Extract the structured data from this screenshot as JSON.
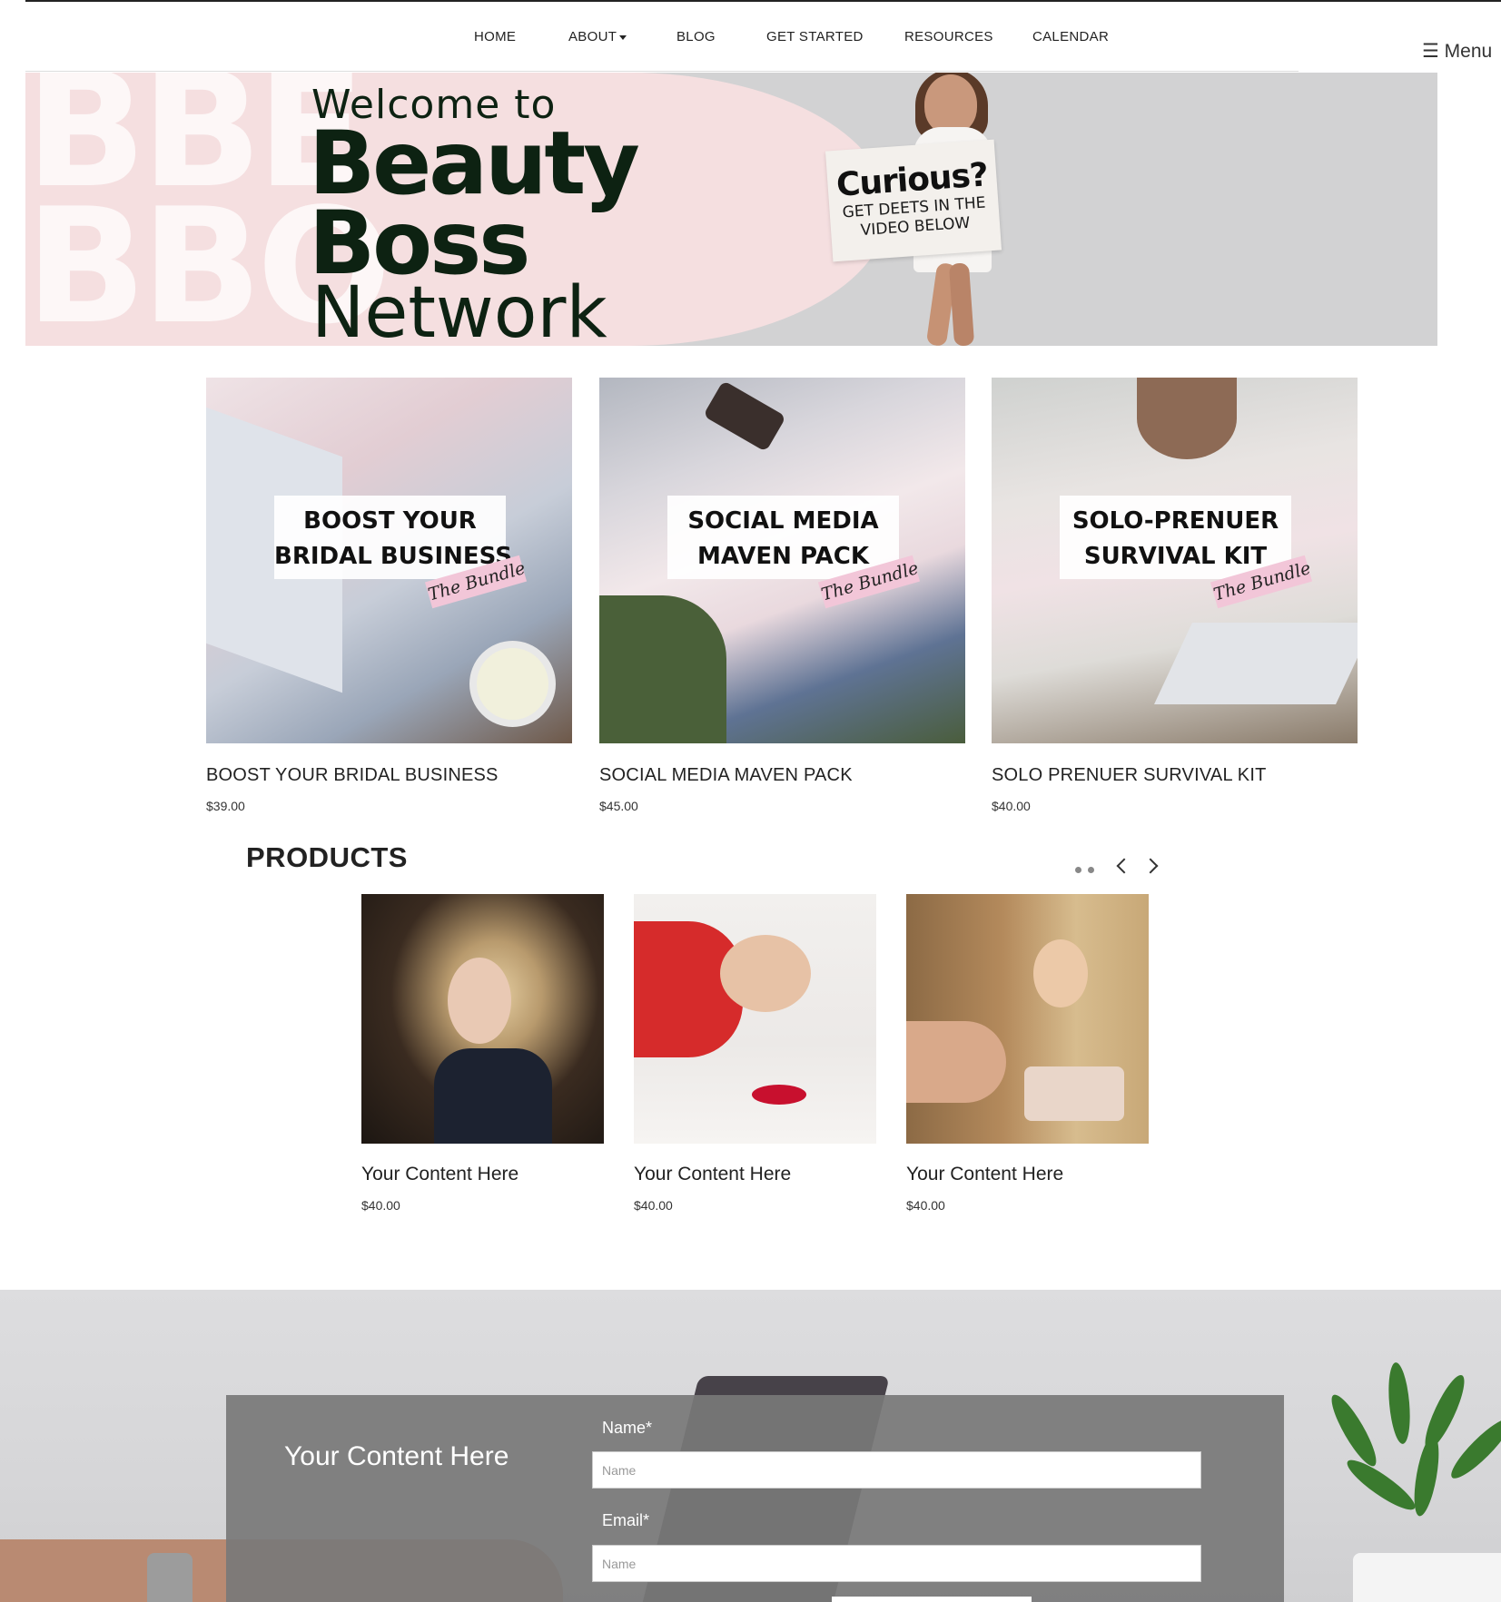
{
  "nav": {
    "items": [
      {
        "label": "HOME"
      },
      {
        "label": "ABOUT"
      },
      {
        "label": "BLOG"
      },
      {
        "label": "GET STARTED"
      },
      {
        "label": "RESOURCES"
      },
      {
        "label": "CALENDAR"
      }
    ],
    "menu_label": "☰ Menu"
  },
  "hero": {
    "welcome": "Welcome to",
    "line1": "Beauty",
    "line2": "Boss",
    "line3": "Network",
    "sign_big": "Curious?",
    "sign_line1": "GET DEETS IN THE",
    "sign_line2": "VIDEO BELOW",
    "colors": {
      "ink": "#0d2212",
      "pink": "#f5dfe0",
      "grey": "#d2d2d3"
    }
  },
  "bundles": [
    {
      "label_line1": "BOOST YOUR",
      "label_line2": "BRIDAL BUSINESS",
      "tag": "The Bundle",
      "title": "BOOST YOUR BRIDAL BUSINESS",
      "price": "$39.00"
    },
    {
      "label_line1": "SOCIAL MEDIA",
      "label_line2": "MAVEN PACK",
      "tag": "The Bundle",
      "title": "SOCIAL MEDIA MAVEN PACK",
      "price": "$45.00"
    },
    {
      "label_line1": "SOLO-PRENUER",
      "label_line2": "SURVIVAL KIT",
      "tag": "The Bundle",
      "title": "SOLO PRENUER SURVIVAL KIT",
      "price": "$40.00"
    }
  ],
  "products": {
    "heading": "PRODUCTS",
    "items": [
      {
        "title": "Your Content Here",
        "price": "$40.00"
      },
      {
        "title": "Your Content Here",
        "price": "$40.00"
      },
      {
        "title": "Your Content Here",
        "price": "$40.00"
      }
    ]
  },
  "contact": {
    "heading": "Your Content Here",
    "name_label": "Name*",
    "name_placeholder": "Name",
    "email_label": "Email*",
    "email_placeholder": "Name"
  }
}
